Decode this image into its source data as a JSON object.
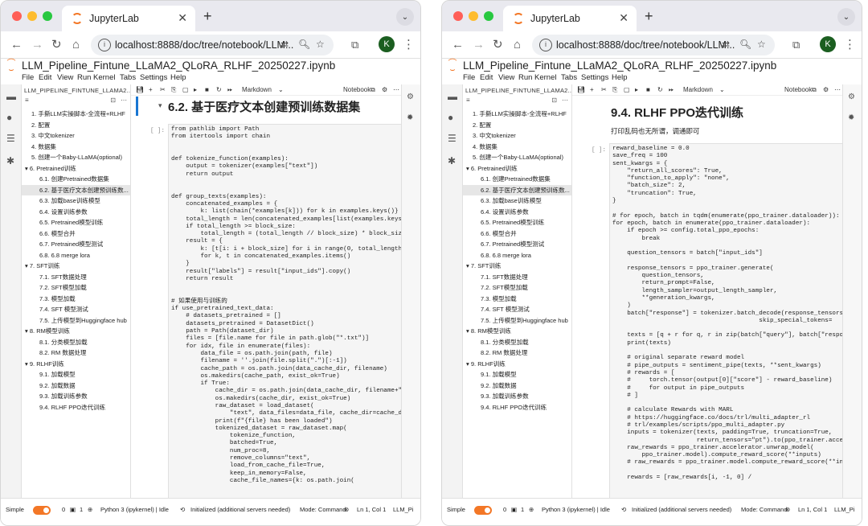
{
  "browser": {
    "tab_title": "JupyterLab",
    "url": "localhost:8888/doc/tree/notebook/LLM...",
    "avatar_letter": "K"
  },
  "notebook": {
    "title": "LLM_Pipeline_Fintune_LLaMA2_QLoRA_RLHF_20250227.ipynb",
    "menu": [
      "File",
      "Edit",
      "View",
      "Run",
      "Kernel",
      "Tabs",
      "Settings",
      "Help"
    ],
    "toc_title": "LLM_PIPELINE_FINTUNE_LLAMA2...",
    "toolbar": {
      "celltype": "Markdown",
      "kernel_label": "Notebook"
    },
    "toc": [
      {
        "label": "1. 手撕LLM实操脚本-全流程+RLHF",
        "level": 1
      },
      {
        "label": "2. 配置",
        "level": 1
      },
      {
        "label": "3. 中文tokenizer",
        "level": 1
      },
      {
        "label": "4. 数据集",
        "level": 1
      },
      {
        "label": "5. 创建一个Baby-LLaMA(optional)",
        "level": 1
      },
      {
        "label": "6. Pretrained训练",
        "level": 1,
        "caret": true
      },
      {
        "label": "6.1. 创建Pretrained数据集",
        "level": 2
      },
      {
        "label": "6.2. 基于医疗文本创建预训练数...",
        "level": 2,
        "active": true
      },
      {
        "label": "6.3. 加载base训练模型",
        "level": 2
      },
      {
        "label": "6.4. 设置训练参数",
        "level": 2
      },
      {
        "label": "6.5. Pretrained模型训练",
        "level": 2
      },
      {
        "label": "6.6. 模型合并",
        "level": 2
      },
      {
        "label": "6.7. Pretrained模型测试",
        "level": 2
      },
      {
        "label": "6.8. 6.8 merge lora",
        "level": 2
      },
      {
        "label": "7. SFT训练",
        "level": 1,
        "caret": true
      },
      {
        "label": "7.1. SFT数据处理",
        "level": 2
      },
      {
        "label": "7.2. SFT模型加载",
        "level": 2
      },
      {
        "label": "7.3. 模型加载",
        "level": 2
      },
      {
        "label": "7.4. SFT 模型测试",
        "level": 2
      },
      {
        "label": "7.5. 上传模型到Huggingface hub",
        "level": 2
      },
      {
        "label": "8. RM模型训练",
        "level": 1,
        "caret": true
      },
      {
        "label": "8.1. 分类模型加载",
        "level": 2
      },
      {
        "label": "8.2. RM 数据处理",
        "level": 2
      },
      {
        "label": "9. RLHF训练",
        "level": 1,
        "caret": true
      },
      {
        "label": "9.1. 加载模型",
        "level": 2
      },
      {
        "label": "9.2. 加载数据",
        "level": 2
      },
      {
        "label": "9.3. 加载训练参数",
        "level": 2
      },
      {
        "label": "9.4. RLHF PPO迭代训练",
        "level": 2
      }
    ]
  },
  "left_panel": {
    "heading": "6.2. 基于医疗文本创建预训练数据集",
    "prompt": "[ ]:",
    "code": [
      "from pathlib import Path",
      "from itertools import chain",
      "",
      "",
      "def tokenize_function(examples):",
      "    output = tokenizer(examples[\"text\"])",
      "    return output",
      "",
      "",
      "def group_texts(examples):",
      "    concatenated_examples = {",
      "        k: list(chain(*examples[k])) for k in examples.keys()}",
      "    total_length = len(concatenated_examples[list(examples.keys())",
      "    if total_length >= block_size:",
      "        total_length = (total_length // block_size) * block_size",
      "    result = {",
      "        k: [t[i: i + block_size] for i in range(0, total_length, bl",
      "        for k, t in concatenated_examples.items()",
      "    }",
      "    result[\"labels\"] = result[\"input_ids\"].copy()",
      "    return result",
      "",
      "",
      "# 如果使用与训练的",
      "if use_pretrained_text_data:",
      "    # datasets_pretrained = []",
      "    datasets_pretrained = DatasetDict()",
      "    path = Path(dataset_dir)",
      "    files = [file.name for file in path.glob(\"*.txt\")]",
      "    for idx, file in enumerate(files):",
      "        data_file = os.path.join(path, file)",
      "        filename = ''.join(file.split(\".\")[:-1])",
      "        cache_path = os.path.join(data_cache_dir, filename)",
      "        os.makedirs(cache_path, exist_ok=True)",
      "        if True:",
      "            cache_dir = os.path.join(data_cache_dir, filename+\"_tex",
      "            os.makedirs(cache_dir, exist_ok=True)",
      "            raw_dataset = load_dataset(",
      "                \"text\", data_files=data_file, cache_dir=cache_dir,",
      "            print(f\"{file} has been loaded\")",
      "            tokenized_dataset = raw_dataset.map(",
      "                tokenize_function,",
      "                batched=True,",
      "                num_proc=8,",
      "                remove_columns=\"text\",",
      "                load_from_cache_file=True,",
      "                keep_in_memory=False,",
      "                cache_file_names={k: os.path.join("
    ],
    "status": {
      "mode_label": "Simple",
      "counts_a": "0",
      "counts_b": "1",
      "kernel": "Python 3 (ipykernel) | Idle",
      "lsp": "Initialized (additional servers needed)",
      "mode": "Mode: Command",
      "pos": "Ln 1, Col 1",
      "file": "LLM_Pi"
    }
  },
  "right_panel": {
    "heading": "9.4. RLHF PPO迭代训练",
    "desc": "打印乱码也无所谓，调通即可",
    "prompt": "[ ]:",
    "code": [
      "reward_baseline = 0.0",
      "save_freq = 100",
      "sent_kwargs = {",
      "    \"return_all_scores\": True,",
      "    \"function_to_apply\": \"none\",",
      "    \"batch_size\": 2,",
      "    \"truncation\": True,",
      "}",
      "",
      "# for epoch, batch in tqdm(enumerate(ppo_trainer.dataloader)):",
      "for epoch, batch in enumerate(ppo_trainer.dataloader):",
      "    if epoch >= config.total_ppo_epochs:",
      "        break",
      "",
      "    question_tensors = batch[\"input_ids\"]",
      "",
      "    response_tensors = ppo_trainer.generate(",
      "        question_tensors,",
      "        return_prompt=False,",
      "        length_sampler=output_length_sampler,",
      "        **generation_kwargs,",
      "    )",
      "    batch[\"response\"] = tokenizer.batch_decode(response_tensors,",
      "                                        skip_special_tokens=",
      "",
      "    texts = [q + r for q, r in zip(batch[\"query\"], batch[\"response\"",
      "    print(texts)",
      "",
      "    # original separate reward model",
      "    # pipe_outputs = sentiment_pipe(texts, **sent_kwargs)",
      "    # rewards = [",
      "    #     torch.tensor(output[0][\"score\"] - reward_baseline)",
      "    #     for output in pipe_outputs",
      "    # ]",
      "",
      "    # calculate Rewards with MARL",
      "    # https://huggingface.co/docs/trl/multi_adapter_rl",
      "    # trl/examples/scripts/ppo_multi_adapter.py",
      "    inputs = tokenizer(texts, padding=True, truncation=True,",
      "                       return_tensors=\"pt\").to(ppo_trainer.accelera",
      "    raw_rewards = ppo_trainer.accelerator.unwrap_model(",
      "        ppo_trainer.model).compute_reward_score(**inputs)",
      "    # raw_rewards = ppo_trainer.model.compute_reward_score(**inputs",
      "",
      "    rewards = [raw_rewards[i, -1, 0] /"
    ],
    "status": {
      "mode_label": "Simple",
      "counts_a": "0",
      "counts_b": "1",
      "kernel": "Python 3 (ipykernel) | Idle",
      "lsp": "Initialized (additional servers needed)",
      "mode": "Mode: Command",
      "pos": "Ln 1, Col 1",
      "file": "LLM_Pi"
    }
  }
}
